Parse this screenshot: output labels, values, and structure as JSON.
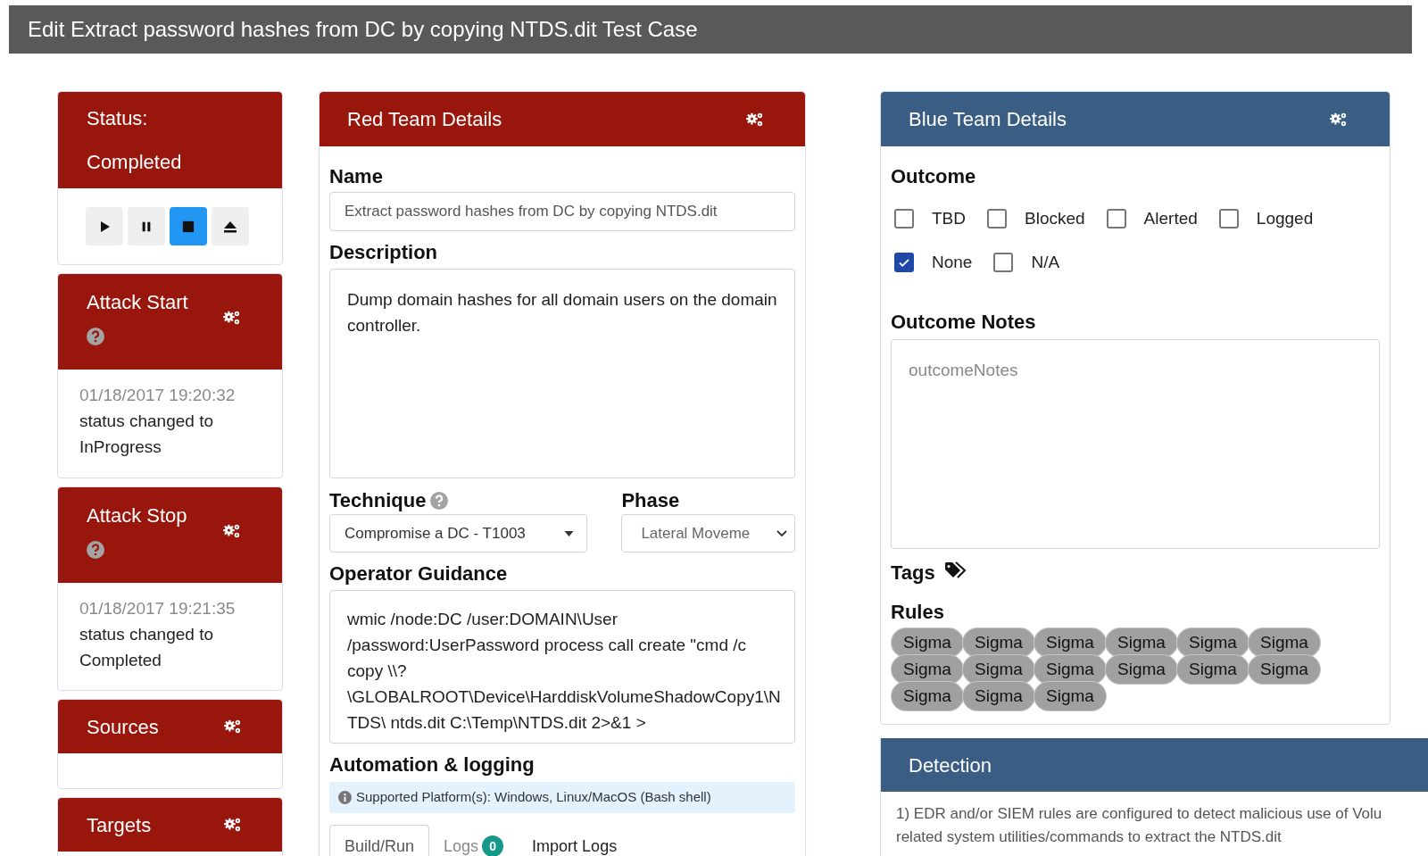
{
  "page_title": "Edit Extract password hashes from DC by copying NTDS.dit Test Case",
  "status_card": {
    "label": "Status:",
    "value": "Completed",
    "controls": [
      {
        "kind": "play",
        "selected": false
      },
      {
        "kind": "pause",
        "selected": false
      },
      {
        "kind": "stop",
        "selected": true
      },
      {
        "kind": "eject",
        "selected": false
      }
    ]
  },
  "attack_start": {
    "title": "Attack Start",
    "timestamp": "01/18/2017 19:20:32",
    "message": "status changed to InProgress"
  },
  "attack_stop": {
    "title": "Attack Stop",
    "timestamp": "01/18/2017 19:21:35",
    "message": "status changed to Completed"
  },
  "sources": {
    "title": "Sources"
  },
  "targets": {
    "title": "Targets"
  },
  "red_team": {
    "title": "Red Team Details",
    "name_label": "Name",
    "name_value": "Extract password hashes from DC by copying NTDS.dit",
    "description_label": "Description",
    "description": "Dump domain hashes for all domain users on the domain controller.",
    "technique_label": "Technique",
    "technique_value": "Compromise a DC - T1003",
    "phase_label": "Phase",
    "phase_value": "Lateral Moveme",
    "guidance_label": "Operator Guidance",
    "guidance": "wmic /node:DC /user:DOMAIN\\User /password:UserPassword process call create \"cmd /c copy \\\\?\\GLOBALROOT\\Device\\HarddiskVolumeShadowCopy1\\NTDS\\ ntds.dit C:\\Temp\\NTDS.dit 2>&1 >",
    "automation_label": "Automation & logging",
    "platform_note": "Supported Platform(s): Windows, Linux/MacOS (Bash shell)",
    "tabs": [
      {
        "label": "Build/Run",
        "selected": true
      },
      {
        "label": "Logs",
        "badge": "0",
        "selected": false
      },
      {
        "label": "Import Logs",
        "selected": false
      }
    ]
  },
  "blue_team": {
    "title": "Blue Team Details",
    "outcome_label": "Outcome",
    "outcomes": [
      {
        "label": "TBD",
        "checked": false
      },
      {
        "label": "Blocked",
        "checked": false
      },
      {
        "label": "Alerted",
        "checked": false
      },
      {
        "label": "Logged",
        "checked": false
      },
      {
        "label": "None",
        "checked": true
      },
      {
        "label": "N/A",
        "checked": false
      }
    ],
    "notes_label": "Outcome Notes",
    "notes_placeholder": "outcomeNotes",
    "tags_label": "Tags",
    "rules_label": "Rules",
    "rules": [
      "Sigma",
      "Sigma",
      "Sigma",
      "Sigma",
      "Sigma",
      "Sigma",
      "Sigma",
      "Sigma",
      "Sigma",
      "Sigma",
      "Sigma",
      "Sigma",
      "Sigma",
      "Sigma",
      "Sigma"
    ]
  },
  "detection": {
    "title": "Detection",
    "lines": [
      "1) EDR and/or SIEM rules are configured to detect malicious use of Volu",
      "related system utilities/commands to extract the NTDS.dit"
    ]
  }
}
